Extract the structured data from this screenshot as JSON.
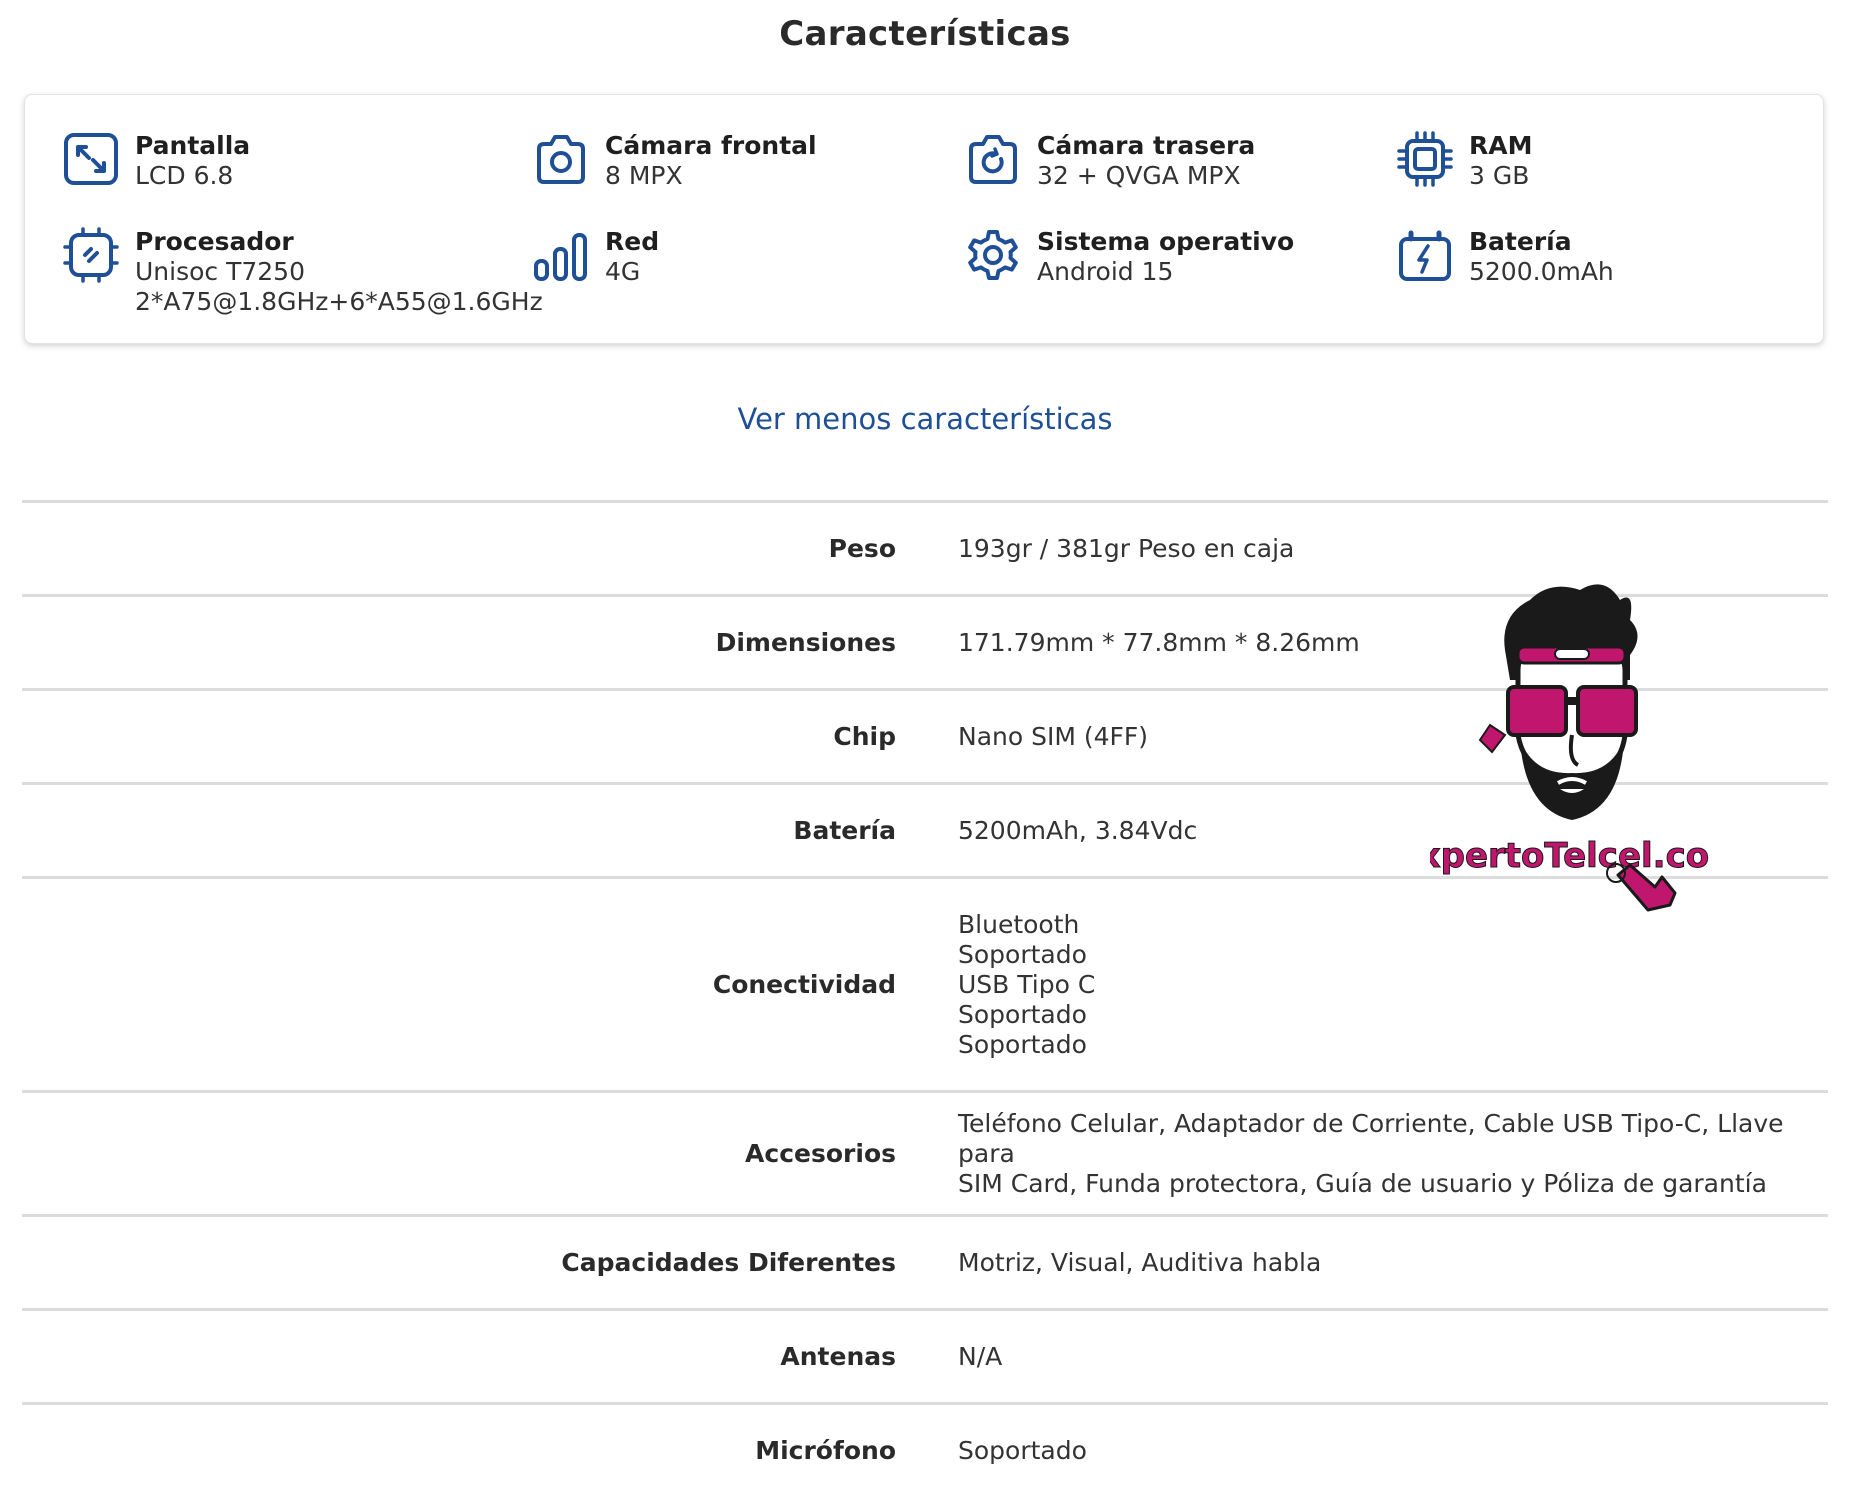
{
  "section_title": "Características",
  "features": [
    {
      "label": "Pantalla",
      "value": "LCD 6.8",
      "icon": "expand-icon"
    },
    {
      "label": "Cámara frontal",
      "value": "8 MPX",
      "icon": "camera-icon"
    },
    {
      "label": "Cámara trasera",
      "value": "32 + QVGA MPX",
      "icon": "camera-rotate-icon"
    },
    {
      "label": "RAM",
      "value": "3 GB",
      "icon": "memory-chip-icon"
    },
    {
      "label": "Procesador",
      "value": "Unisoc T7250",
      "value2": "2*A75@1.8GHz+6*A55@1.6GHz",
      "icon": "processor-icon"
    },
    {
      "label": "Red",
      "value": "4G",
      "icon": "signal-bars-icon"
    },
    {
      "label": "Sistema operativo",
      "value": "Android 15",
      "icon": "gear-icon"
    },
    {
      "label": "Batería",
      "value": "5200.0mAh",
      "icon": "battery-icon"
    }
  ],
  "toggle_link": "Ver menos características",
  "specs": [
    {
      "label": "Peso",
      "value": "193gr / 381gr Peso en caja"
    },
    {
      "label": "Dimensiones",
      "value": "171.79mm * 77.8mm * 8.26mm"
    },
    {
      "label": "Chip",
      "value": "Nano SIM (4FF)"
    },
    {
      "label": "Batería",
      "value": "5200mAh, 3.84Vdc"
    },
    {
      "label": "Conectividad",
      "lines": [
        "Bluetooth",
        "Soportado",
        "USB Tipo C",
        "Soportado",
        "Soportado"
      ]
    },
    {
      "label": "Accesorios",
      "lines": [
        "Teléfono Celular, Adaptador de Corriente, Cable USB Tipo-C, Llave para",
        "SIM Card, Funda protectora, Guía de usuario y Póliza de garantía"
      ]
    },
    {
      "label": "Capacidades Diferentes",
      "value": "Motriz, Visual, Auditiva habla"
    },
    {
      "label": "Antenas",
      "value": "N/A"
    },
    {
      "label": "Micrófono",
      "value": "Soportado"
    }
  ],
  "watermark_text": "ExpertoTelcel.com",
  "colors": {
    "icon_blue": "#1f4f97",
    "link_blue": "#1f4f97",
    "watermark_magenta": "#c0166e",
    "divider": "#dcdcdc"
  }
}
